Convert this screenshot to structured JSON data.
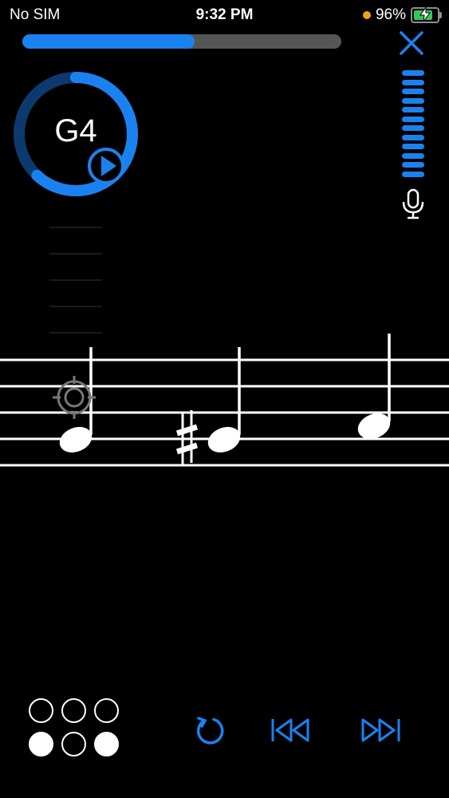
{
  "status": {
    "carrier": "No SIM",
    "time": "9:32 PM",
    "battery_text": "96%",
    "battery_level": 0.96
  },
  "progress": {
    "fraction": 0.54
  },
  "tuner": {
    "note": "G4",
    "ring_fraction": 0.62
  },
  "mic_meter": {
    "segments_lit": 12
  },
  "staff": {
    "notes": [
      {
        "name": "note-1",
        "accidental": "",
        "position": "space-below-middle"
      },
      {
        "name": "note-2",
        "accidental": "♯",
        "position": "space-below-middle"
      },
      {
        "name": "note-3",
        "accidental": "",
        "position": "line-middle"
      }
    ]
  },
  "valves": {
    "top_row": [
      "open",
      "open",
      "open"
    ],
    "bottom_row": [
      "pressed",
      "open",
      "pressed"
    ]
  },
  "controls": [
    {
      "name": "replay-button",
      "icon": "replay-icon"
    },
    {
      "name": "rewind-button",
      "icon": "rewind-icon"
    },
    {
      "name": "fast-forward-button",
      "icon": "fast-forward-icon"
    }
  ],
  "colors": {
    "accent": "#1a82f0",
    "background": "#000000",
    "ring_track": "#0d3a6e",
    "battery": "#34c759"
  }
}
